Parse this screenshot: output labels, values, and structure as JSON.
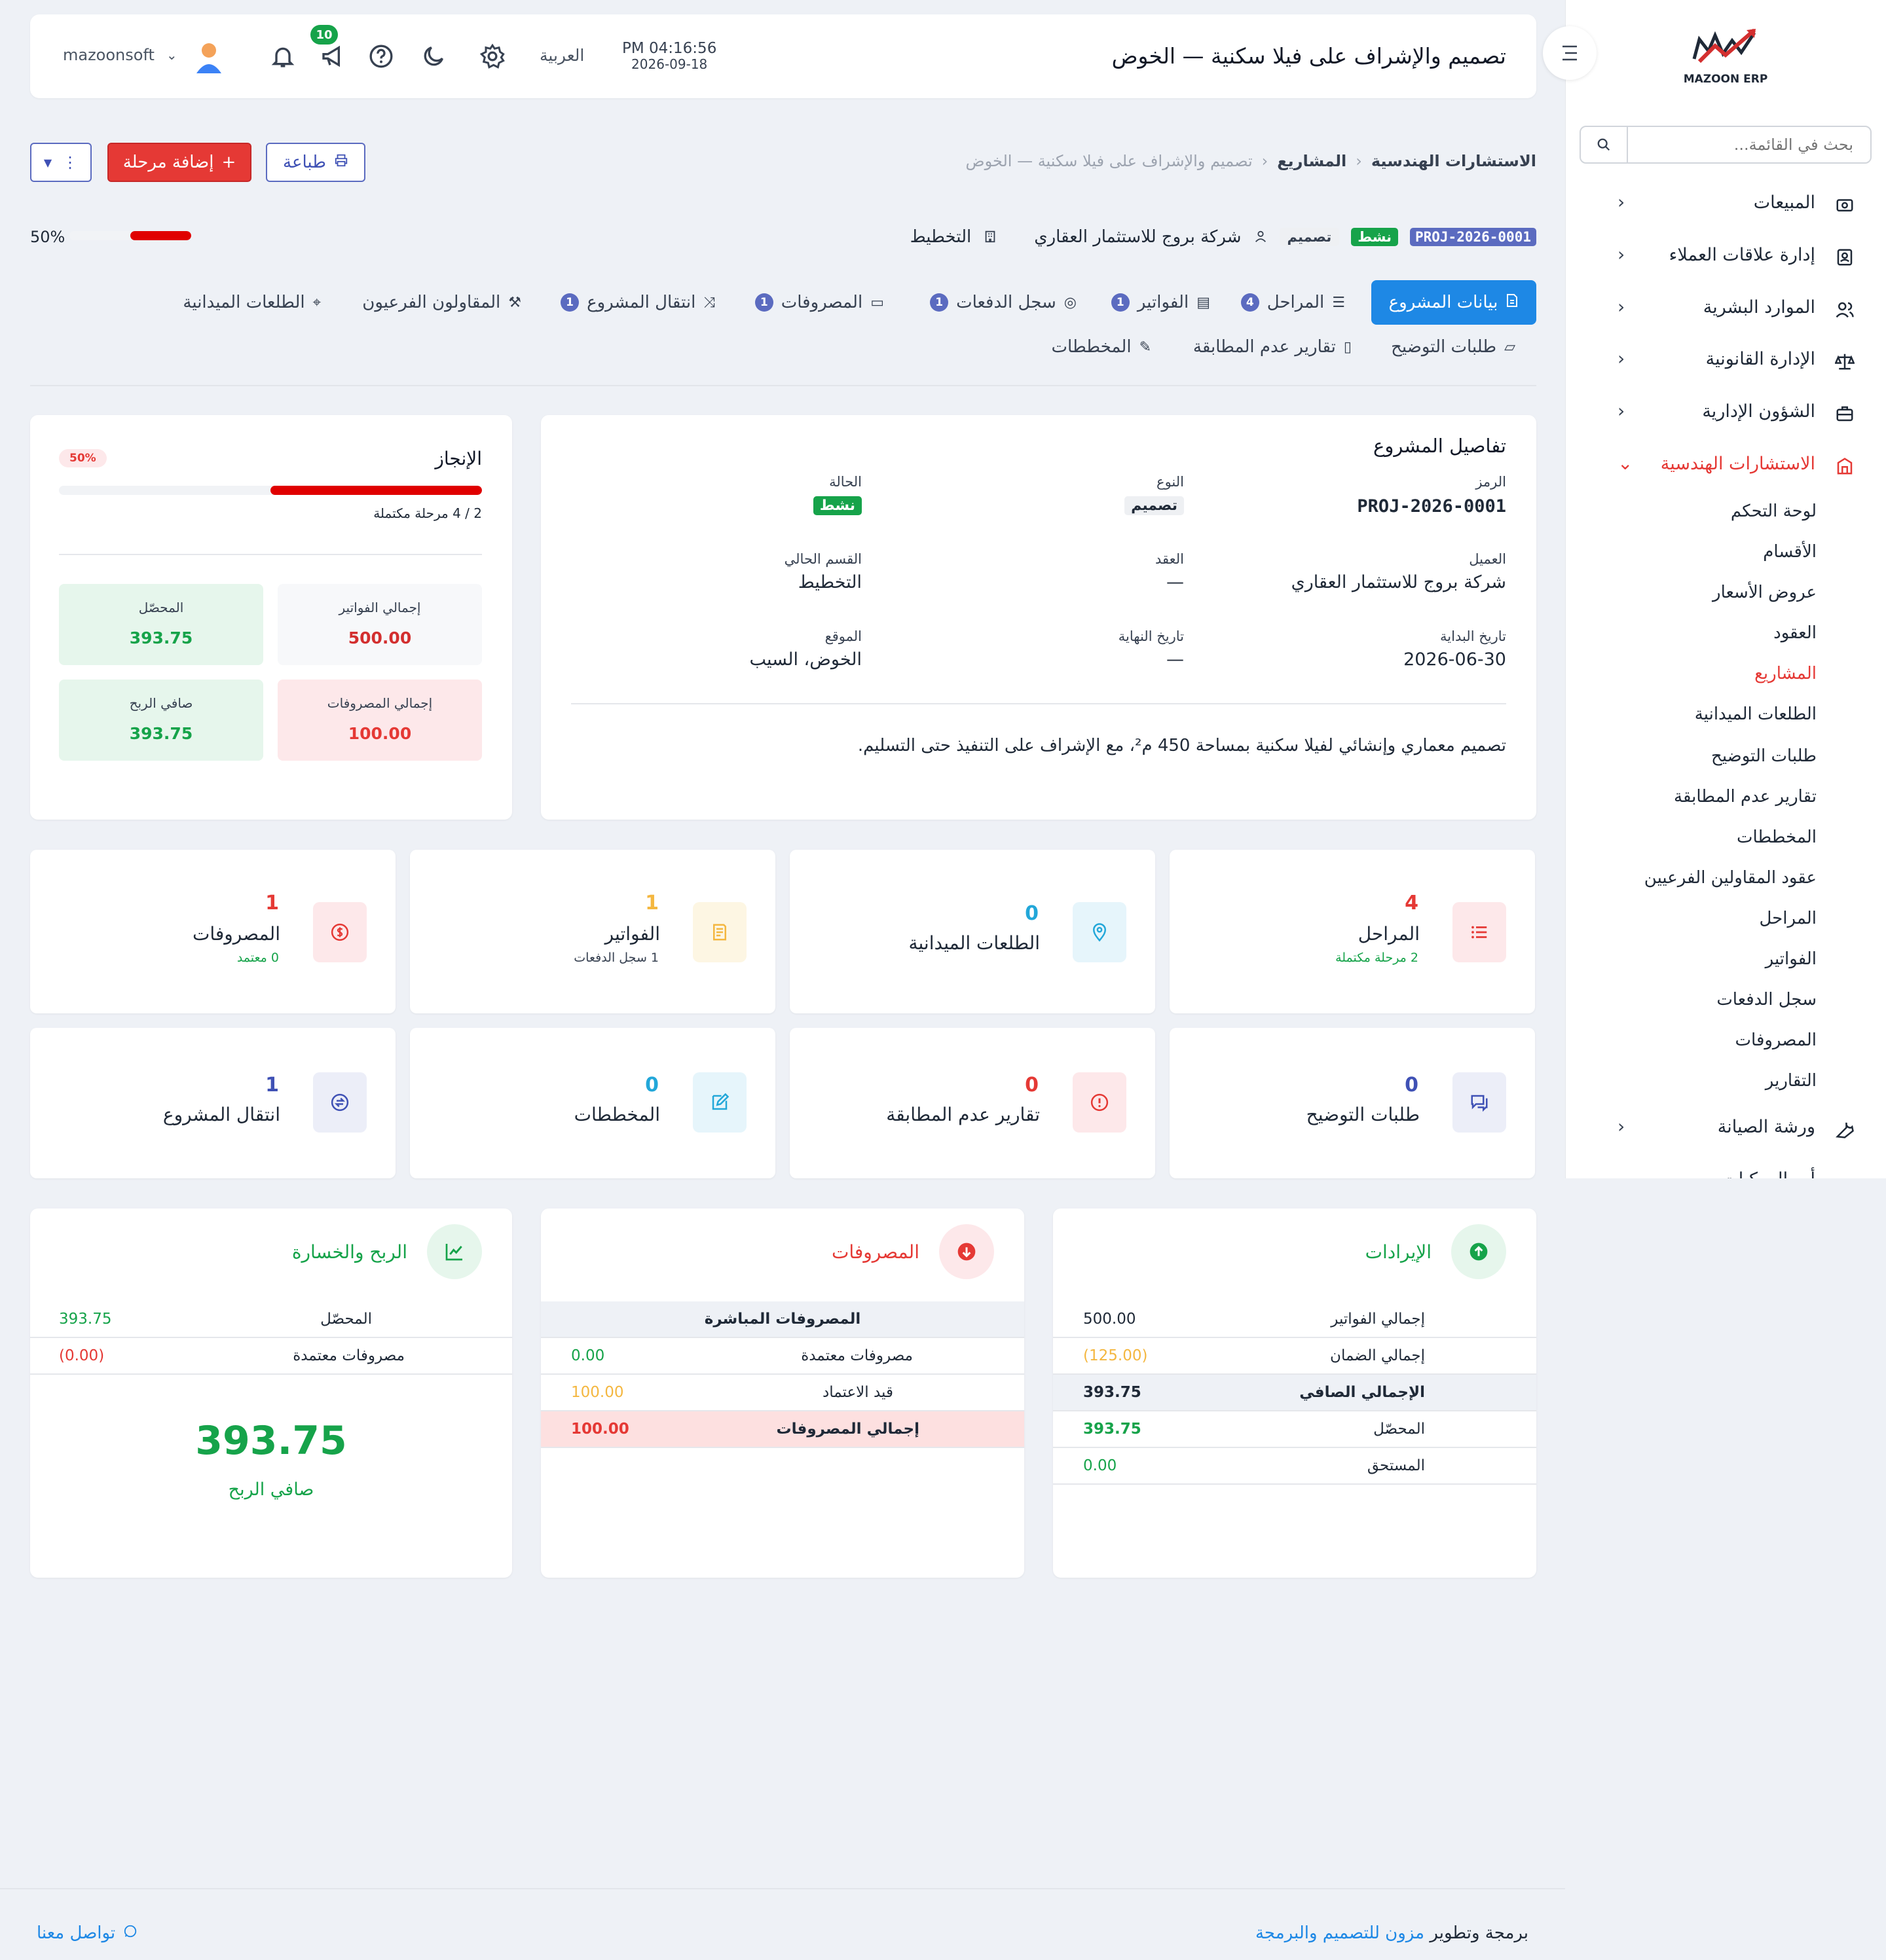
{
  "sidebar": {
    "brand_name": "MAZOON ERP",
    "search_placeholder": "بحث في القائمة...",
    "menu": [
      {
        "label": "المبيعات",
        "icon": "sales-icon"
      },
      {
        "label": "إدارة علاقات العملاء",
        "icon": "crm-icon"
      },
      {
        "label": "الموارد البشرية",
        "icon": "users-icon"
      },
      {
        "label": "الإدارة القانونية",
        "icon": "scale-icon"
      },
      {
        "label": "الشؤون الإدارية",
        "icon": "briefcase-icon"
      },
      {
        "label": "الاستشارات الهندسية",
        "icon": "building-icon"
      }
    ],
    "sub_items": [
      "لوحة التحكم",
      "الأقسام",
      "عروض الأسعار",
      "العقود",
      "المشاريع",
      "الطلعات الميدانية",
      "طلبات التوضيح",
      "تقارير عدم المطابقة",
      "المخططات",
      "عقود المقاولين الفرعيين",
      "المراحل",
      "الفواتير",
      "سجل الدفعات",
      "المصروفات",
      "التقارير"
    ],
    "after": {
      "label": "ورشة الصيانة",
      "icon": "wrench-icon"
    },
    "cut_label": "أ... المركبات"
  },
  "topbar": {
    "title": "تصميم والإشراف على فيلا سكنية — الخوض",
    "time": "PM 04:16:56",
    "date": "2026-09-18",
    "language": "العربية",
    "notifications_count": "10",
    "user": "mazoonsoft"
  },
  "breadcrumb": {
    "root": "الاستشارات الهندسية",
    "parent": "المشاريع",
    "current": "تصميم والإشراف على فيلا سكنية — الخوض"
  },
  "actions": {
    "print": "طباعة",
    "add_stage": "إضافة مرحلة"
  },
  "summary": {
    "code": "PROJ-2026-0001",
    "status": "نشط",
    "type": "تصميم",
    "client": "شركة بروج للاستثمار العقاري",
    "section": "التخطيط",
    "progress": "50%",
    "progress_value": 0.5
  },
  "tabs": [
    {
      "label": "بيانات المشروع",
      "count": ""
    },
    {
      "label": "المراحل",
      "count": "4"
    },
    {
      "label": "الفواتير",
      "count": "1"
    },
    {
      "label": "سجل الدفعات",
      "count": "1"
    },
    {
      "label": "المصروفات",
      "count": "1"
    },
    {
      "label": "انتقال المشروع",
      "count": "1"
    },
    {
      "label": "المقاولون الفرعيون",
      "count": ""
    },
    {
      "label": "الطلعات الميدانية",
      "count": ""
    },
    {
      "label": "طلبات التوضيح",
      "count": ""
    },
    {
      "label": "تقارير عدم المطابقة",
      "count": ""
    },
    {
      "label": "المخططات",
      "count": ""
    }
  ],
  "details": {
    "heading": "تفاصيل المشروع",
    "code_label": "الرمز",
    "code": "PROJ-2026-0001",
    "type_label": "النوع",
    "type": "تصميم",
    "status_label": "الحالة",
    "status": "نشط",
    "client_label": "العميل",
    "client": "شركة بروج للاستثمار العقاري",
    "contract_label": "العقد",
    "contract": "—",
    "section_label": "القسم الحالي",
    "section": "التخطيط",
    "start_label": "تاريخ البداية",
    "start": "2026-06-30",
    "end_label": "تاريخ النهاية",
    "end": "—",
    "location_label": "الموقع",
    "location": "الخوض، السيب",
    "description": "تصميم معماري وإنشائي لفيلا سكنية بمساحة 450 م²، مع الإشراف على التنفيذ حتى التسليم."
  },
  "achievement": {
    "heading": "الإنجاز",
    "percent": "50%",
    "percent_value": 0.5,
    "completed_text": "2 / 4 مرحلة مكتملة",
    "invoices_total_label": "إجمالي الفواتير",
    "invoices_total": "500.00",
    "collected_label": "المحصّل",
    "collected": "393.75",
    "expenses_total_label": "إجمالي المصروفات",
    "expenses_total": "100.00",
    "net_profit_label": "صافي الربح",
    "net_profit": "393.75"
  },
  "stats": [
    {
      "title": "المراحل",
      "value": "4",
      "sub": "2 مرحلة مكتملة",
      "icon": "list-icon",
      "color": "#e53935",
      "bg": "#fde8ea",
      "subcolor": "#16a34a"
    },
    {
      "title": "الطلعات الميدانية",
      "value": "0",
      "sub": "",
      "icon": "location-icon",
      "color": "#22a7d9",
      "bg": "#e6f5fb",
      "subcolor": ""
    },
    {
      "title": "الفواتير",
      "value": "1",
      "sub": "1 سجل الدفعات",
      "icon": "invoice-icon",
      "color": "#f4b740",
      "bg": "#fdf6e3",
      "subcolor": "#374151"
    },
    {
      "title": "المصروفات",
      "value": "1",
      "sub": "0 معتمد",
      "icon": "dollar-icon",
      "color": "#e53935",
      "bg": "#fde8ea",
      "subcolor": "#16a34a"
    },
    {
      "title": "طلبات التوضيح",
      "value": "0",
      "sub": "",
      "icon": "chat-icon",
      "color": "#3f51b5",
      "bg": "#eceef8",
      "subcolor": ""
    },
    {
      "title": "تقارير عدم المطابقة",
      "value": "0",
      "sub": "",
      "icon": "alert-icon",
      "color": "#e53935",
      "bg": "#fde8ea",
      "subcolor": ""
    },
    {
      "title": "المخططات",
      "value": "0",
      "sub": "",
      "icon": "edit-icon",
      "color": "#22a7d9",
      "bg": "#e6f5fb",
      "subcolor": ""
    },
    {
      "title": "انتقال المشروع",
      "value": "1",
      "sub": "",
      "icon": "transfer-icon",
      "color": "#3f51b5",
      "bg": "#eceef8",
      "subcolor": ""
    }
  ],
  "revenue": {
    "heading": "الإيرادات",
    "rows": [
      {
        "label": "إجمالي الفواتير",
        "value": "500.00"
      },
      {
        "label": "إجمالي الضمان",
        "value": "(125.00)"
      },
      {
        "label": "الإجمالي الصافي",
        "value": "393.75"
      },
      {
        "label": "المحصّل",
        "value": "393.75"
      },
      {
        "label": "المستحق",
        "value": "0.00"
      }
    ]
  },
  "expenses": {
    "heading": "المصروفات",
    "subheading": "المصروفات المباشرة",
    "rows": [
      {
        "label": "مصروفات معتمدة",
        "value": "0.00"
      },
      {
        "label": "قيد الاعتماد",
        "value": "100.00"
      },
      {
        "label": "إجمالي المصروفات",
        "value": "100.00"
      }
    ]
  },
  "profit": {
    "heading": "الربح والخسارة",
    "rows": [
      {
        "label": "المحصّل",
        "value": "393.75"
      },
      {
        "label": "مصروفات معتمدة",
        "value": "(0.00)"
      }
    ],
    "big_value": "393.75",
    "big_label": "صافي الربح"
  },
  "footer": {
    "left_prefix": "برمجة وتطوير",
    "left_link": "مزون للتصميم والبرمجة",
    "contact": "تواصل معنا"
  },
  "colors": {
    "primary": "#1e88e5",
    "danger": "#e53935",
    "success": "#16a34a",
    "accent": "#5b6bc0"
  }
}
